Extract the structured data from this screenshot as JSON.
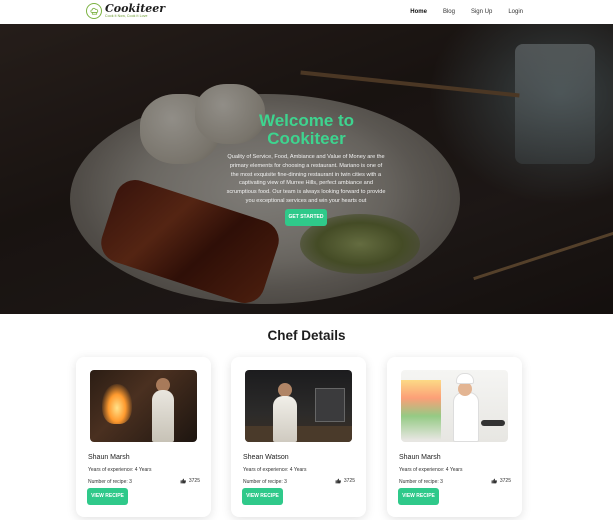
{
  "nav": {
    "brand": "Cookiteer",
    "tagline": "Cook it Now, Cook it Love",
    "links": [
      "Home",
      "Blog",
      "Sign Up",
      "Login"
    ],
    "active": "Home"
  },
  "hero": {
    "title": "Welcome to Cookiteer",
    "description": "Quality of Service, Food, Ambiance and Value of Money are the primary elements for choosing a restaurant. Mariano is one of the most exquisite fine-dinning restaurant in twin cities with a captivating view of Murree Hills, perfect ambiance and scrumptious food. Our team is always looking forward to provide you exceptional services and win your hearts out",
    "button": "GET STARTED"
  },
  "chefs": {
    "title": "Chef Details",
    "items": [
      {
        "name": "Shaun Marsh",
        "experience": "Years of experience: 4 Years",
        "recipes": "Number of recipe: 3",
        "likes": "3725",
        "button": "VIEW RECIPE"
      },
      {
        "name": "Shean Watson",
        "experience": "Years of experience: 4 Years",
        "recipes": "Number of recipe: 3",
        "likes": "3725",
        "button": "VIEW RECIPE"
      },
      {
        "name": "Shaun Marsh",
        "experience": "Years of experience: 4 Years",
        "recipes": "Number of recipe: 3",
        "likes": "3725",
        "button": "VIEW RECIPE"
      }
    ]
  },
  "colors": {
    "accent": "#2fc98a",
    "title_green": "#3ed48f",
    "logo_green": "#7cb342"
  }
}
